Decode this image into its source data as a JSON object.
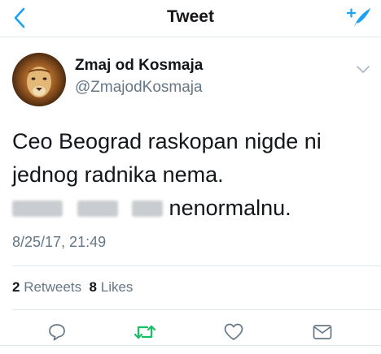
{
  "nav": {
    "title": "Tweet"
  },
  "tweet": {
    "author": {
      "display_name": "Zmaj od Kosmaja",
      "handle": "@ZmajodKosmaja",
      "avatar": "lion-avatar"
    },
    "text_line1": "Ceo Beograd raskopan nigde ni",
    "text_line2": "jednog radnika nema.",
    "text_line3_visible": "nenormalnu.",
    "timestamp": "8/25/17, 21:49",
    "retweets_count": "2",
    "retweets_label": "Retweets",
    "likes_count": "8",
    "likes_label": "Likes"
  },
  "icons": {
    "back": "chevron-left-icon",
    "compose": "compose-tweet-icon",
    "caret": "chevron-down-icon",
    "reply": "reply-icon",
    "retweet": "retweet-icon",
    "like": "heart-icon",
    "dm": "envelope-icon"
  },
  "colors": {
    "accent": "#1da1f2",
    "retweet_active": "#17bf63",
    "secondary_text": "#657786",
    "divider": "#e1e8ed"
  }
}
